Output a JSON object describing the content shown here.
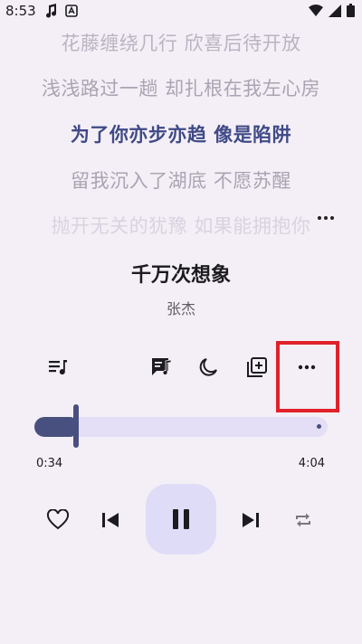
{
  "status": {
    "time": "8:53",
    "icons": [
      "music-note-icon",
      "notification-a-icon",
      "wifi-icon",
      "signal-icon",
      "battery-icon"
    ]
  },
  "lyrics": [
    "花藤缠绕几行 欣喜后待开放",
    "浅浅路过一趟 却扎根在我左心房",
    "为了你亦步亦趋 像是陷阱",
    "留我沉入了湖底 不愿苏醒",
    "抛开无关的犹豫 如果能拥抱你"
  ],
  "song": {
    "title": "千万次想象",
    "artist": "张杰"
  },
  "toolbar": {
    "icons": [
      "queue-icon",
      "lyrics-icon",
      "sleep-timer-icon",
      "add-to-playlist-icon",
      "more-icon"
    ]
  },
  "progress": {
    "current": "0:34",
    "total": "4:04",
    "fraction": 0.139
  },
  "colors": {
    "background": "#f4eff6",
    "accent": "#48507f",
    "active_lyric": "#3f4a86",
    "highlight": "#e0212a"
  }
}
